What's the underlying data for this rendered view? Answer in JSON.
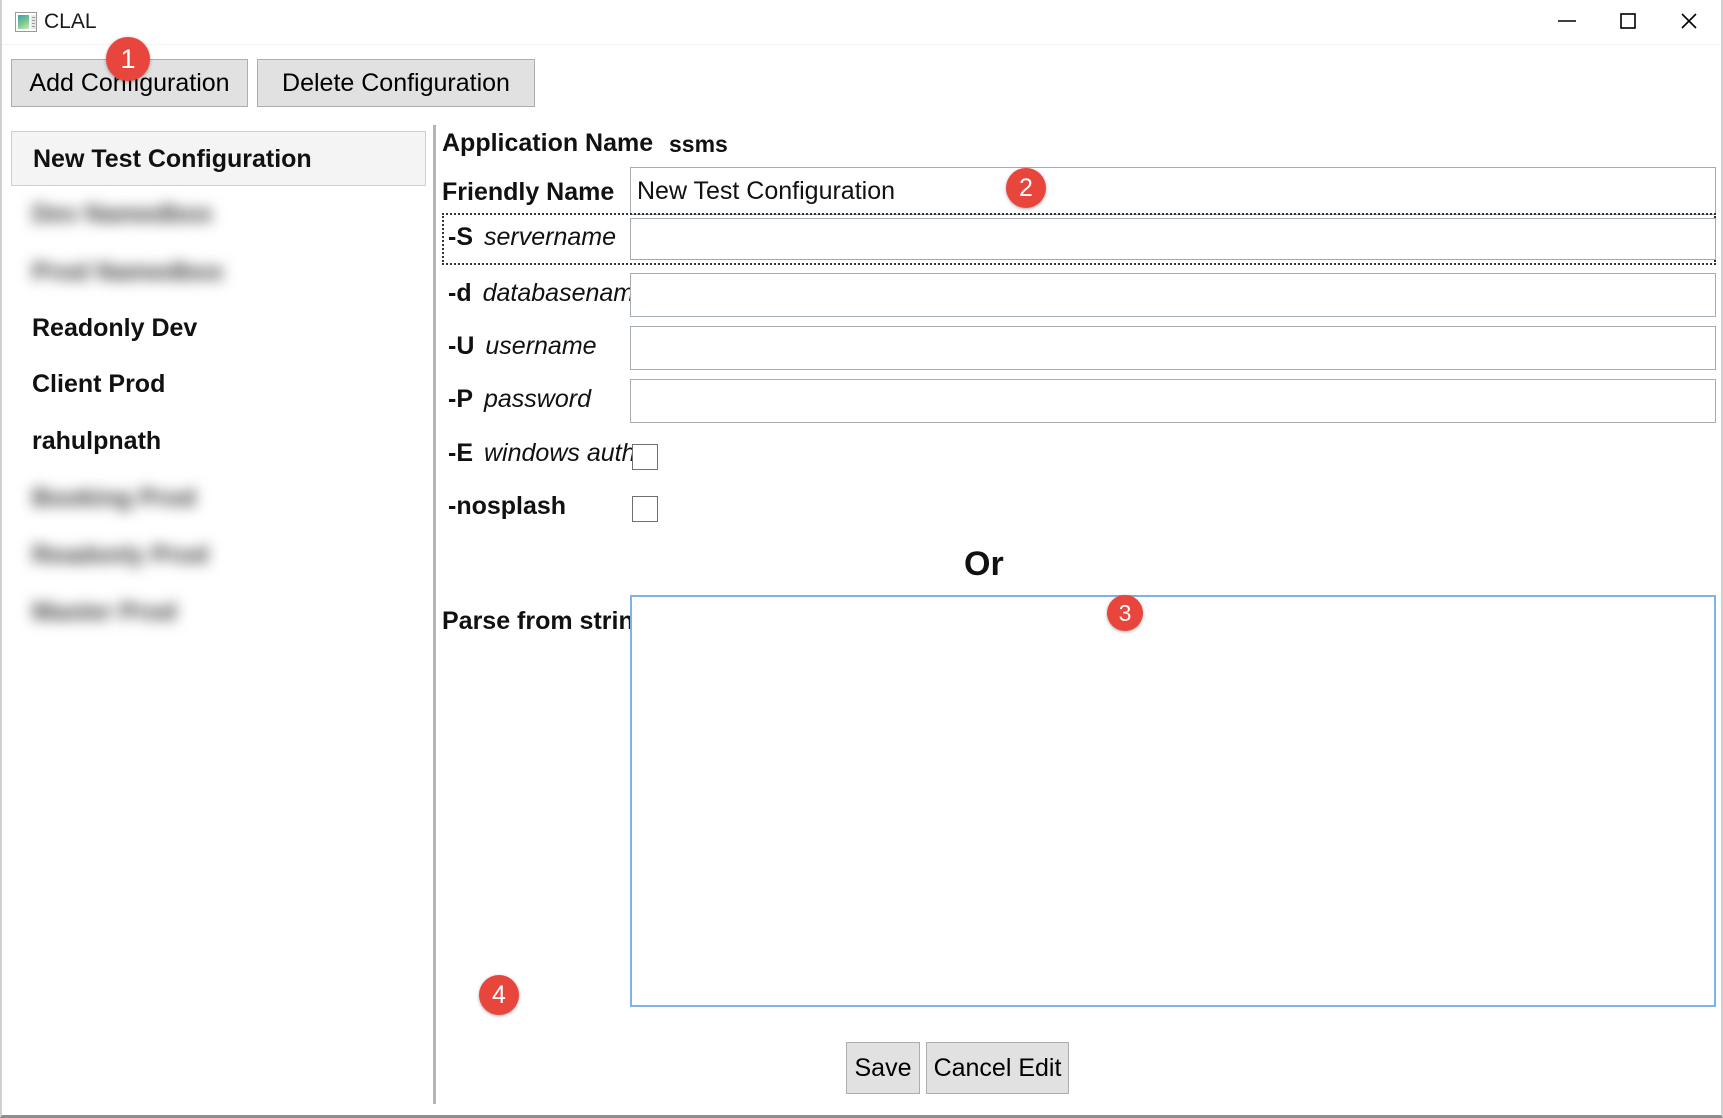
{
  "window": {
    "title": "CLAL",
    "icon": "app-window-icon",
    "controls": {
      "minimize": "minimize-icon",
      "maximize": "maximize-icon",
      "close": "close-icon"
    }
  },
  "toolbar": {
    "add_label": "Add Configuration",
    "delete_label": "Delete Configuration"
  },
  "sidebar": {
    "items": [
      {
        "label": "New Test Configuration",
        "selected": true,
        "redacted": false
      },
      {
        "label": "Dev Namedbox",
        "selected": false,
        "redacted": true
      },
      {
        "label": "Prod Namedbox",
        "selected": false,
        "redacted": true
      },
      {
        "label": "Readonly Dev",
        "selected": false,
        "redacted": false
      },
      {
        "label": "Client Prod",
        "selected": false,
        "redacted": false
      },
      {
        "label": "rahulpnath",
        "selected": false,
        "redacted": false
      },
      {
        "label": "Booking Prod",
        "selected": false,
        "redacted": true
      },
      {
        "label": "Readonly Prod",
        "selected": false,
        "redacted": true
      },
      {
        "label": "Master Prod",
        "selected": false,
        "redacted": true
      }
    ]
  },
  "form": {
    "application_name_label": "Application Name",
    "application_name_value": "ssms",
    "friendly_name_label": "Friendly Name",
    "friendly_name_value": "New Test Configuration",
    "friendly_name_placeholder": "",
    "fields": [
      {
        "flag": "-S",
        "arg": "servername",
        "value": "",
        "placeholder": "",
        "focused": true
      },
      {
        "flag": "-d",
        "arg": "databasename",
        "value": "",
        "placeholder": "",
        "focused": false
      },
      {
        "flag": "-U",
        "arg": "username",
        "value": "",
        "placeholder": "",
        "focused": false
      },
      {
        "flag": "-P",
        "arg": "password",
        "value": "",
        "placeholder": "",
        "focused": false
      }
    ],
    "checkboxes": [
      {
        "flag": "-E",
        "arg": "windows auth",
        "checked": false
      },
      {
        "flag": "-nosplash",
        "arg": "",
        "checked": false
      }
    ],
    "or_label": "Or",
    "parse_label": "Parse from string",
    "parse_value": "",
    "parse_placeholder": "",
    "save_label": "Save",
    "cancel_label": "Cancel Edit"
  },
  "markers": {
    "one": "1",
    "two": "2",
    "three": "3",
    "four": "4"
  },
  "colors": {
    "marker_red": "#e8453c",
    "focus_blue": "#7eb3e8",
    "button_face": "#e1e1e1",
    "selected_row": "#f4f4f4"
  }
}
